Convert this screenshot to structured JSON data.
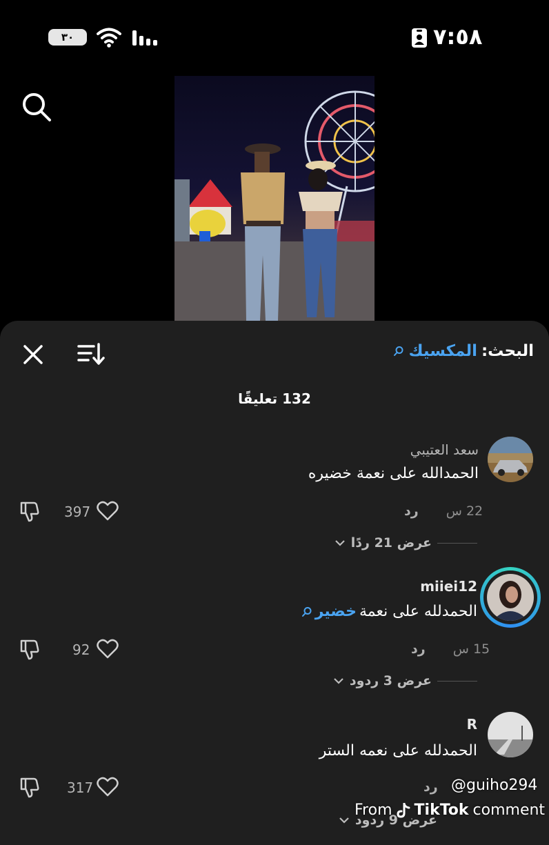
{
  "status": {
    "time": "٧:٥٨",
    "battery": "٣٠"
  },
  "panel": {
    "search_label": "البحث:",
    "search_term": "المكسيك",
    "comment_count": "132 تعليقًا"
  },
  "comments": [
    {
      "username": "سعد العتيبي",
      "text": "الحمدالله على نعمة خضيره",
      "time": "22 س",
      "reply_label": "رد",
      "likes": "397",
      "view_replies": "عرض 21 ردًا"
    },
    {
      "username": "miiei12",
      "text_prefix": "الحمدلله على نعمة",
      "text_highlight": "خضير",
      "time": "15 س",
      "reply_label": "رد",
      "likes": "92",
      "view_replies": "عرض 3 ردود"
    },
    {
      "username": "R",
      "text": "الحمدلله على نعمه الستر",
      "reply_label": "رد",
      "likes": "317",
      "view_replies": "عرض 9 ردود"
    }
  ],
  "watermark": {
    "user": "@guiho294",
    "from": "From",
    "brand": "TikTok",
    "suffix": "comment"
  },
  "icons": [
    "search-icon",
    "close-icon",
    "sort-icon",
    "like-icon",
    "dislike-icon",
    "chevron-down-icon",
    "wifi-icon",
    "signal-icon",
    "battery-icon",
    "tiktok-logo-icon"
  ],
  "colors": {
    "background": "#000000",
    "panel": "#1f1f1f",
    "accent": "#4aa3f0"
  }
}
